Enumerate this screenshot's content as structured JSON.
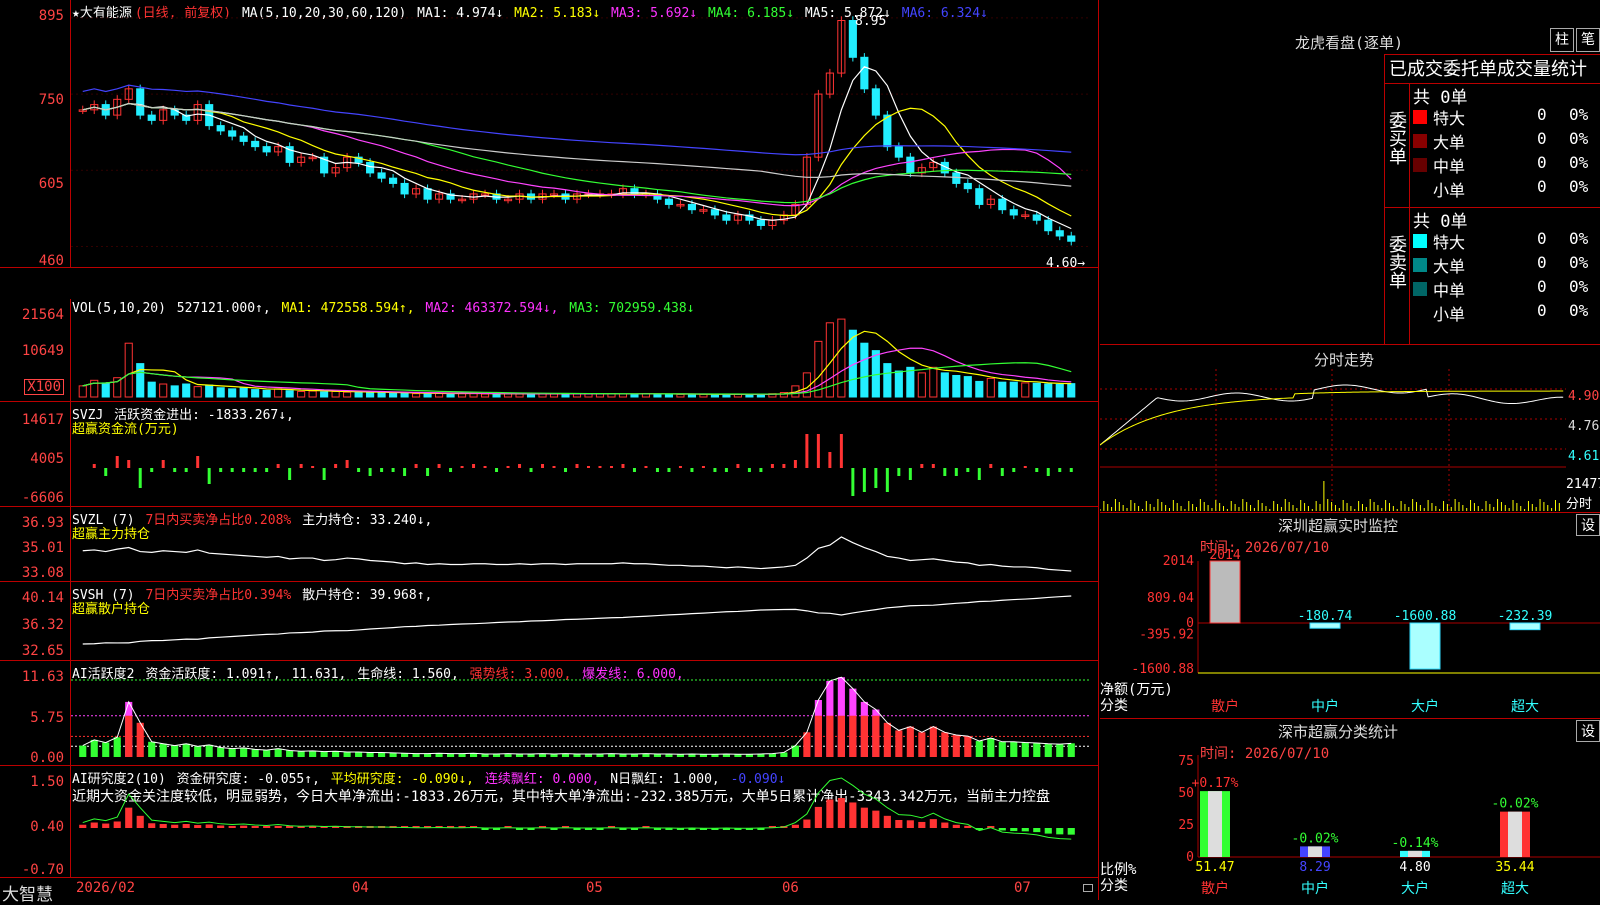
{
  "colors": {
    "up": "#ff3333",
    "down": "#22eeff",
    "ma1": "#ffffff",
    "ma2": "#ffff00",
    "ma3": "#ff44ff",
    "ma4": "#33ff33",
    "ma5": "#cccccc",
    "ma6": "#4444ff",
    "grid": "#aa0000"
  },
  "main": {
    "title": "★大有能源",
    "mode": "(日线, 前复权)",
    "legend": [
      "MA(5,10,20,30,60,120)",
      "MA1: 4.974↓",
      "MA2: 5.183↓",
      "MA3: 5.692↓",
      "MA4: 6.185↓",
      "MA5: 5.872↓",
      "MA6: 6.324↓"
    ],
    "ticks": [
      "895",
      "750",
      "605",
      "460"
    ],
    "high_label": "8.95",
    "low_label": "4.60→"
  },
  "vol": {
    "legend": [
      "VOL(5,10,20)",
      "527121.000↑,",
      "MA1: 472558.594↑,",
      "MA2: 463372.594↓,",
      "MA3: 702959.438↓"
    ],
    "ticks": [
      "21564",
      "10649",
      "X100"
    ]
  },
  "svzj": {
    "legend": [
      "SVZJ",
      "活跃资金进出: -1833.267↓,"
    ],
    "sub": "超赢资金流(万元)",
    "ticks": [
      "14617",
      "4005",
      "-6606"
    ]
  },
  "svzl": {
    "legend": [
      "SVZL (7)",
      "7日内买卖净占比0.208%",
      "主力持仓: 33.240↓,"
    ],
    "sub": "超赢主力持仓",
    "ticks": [
      "36.93",
      "35.01",
      "33.08"
    ]
  },
  "svsh": {
    "legend": [
      "SVSH (7)",
      "7日内买卖净占比0.394%",
      "散户持仓: 39.968↑,"
    ],
    "sub": "超赢散户持仓",
    "ticks": [
      "40.14",
      "36.32",
      "32.65"
    ]
  },
  "ai1": {
    "legend": [
      "AI活跃度2",
      "资金活跃度: 1.091↑,",
      "11.631,",
      "生命线: 1.560,",
      "强势线: 3.000,",
      "爆发线: 6.000,"
    ],
    "ticks": [
      "11.63",
      "5.75",
      "0.00"
    ]
  },
  "ai2": {
    "legend": [
      "AI研究度2(10)",
      "资金研究度: -0.055↑,",
      "平均研究度: -0.090↓,",
      "连续飘红: 0.000,",
      "N日飘红: 1.000,",
      "-0.090↓"
    ],
    "text": "近期大资金关注度较低，明显弱势，今日大单净流出:-1833.26万元，其中特大单净流出:-232.385万元，大单5日累计净出-3343.342万元，当前主力控盘",
    "ticks": [
      "1.50",
      "0.40",
      "-0.70"
    ]
  },
  "bottom": {
    "brand": "大智慧",
    "dates": [
      "2026/02",
      "04",
      "05",
      "06",
      "07"
    ]
  },
  "right": {
    "dragon": {
      "title": "龙虎看盘(逐单)",
      "btn1": "柱",
      "btn2": "笔",
      "header": "已成交委托单成交量统计",
      "buy_label": "委买单",
      "sell_label": "委卖单",
      "buy_total": "共 0单",
      "sell_total": "共 0单",
      "rows_buy": [
        {
          "name": "特大",
          "v": "0",
          "p": "0%"
        },
        {
          "name": "大单",
          "v": "0",
          "p": "0%"
        },
        {
          "name": "中单",
          "v": "0",
          "p": "0%"
        },
        {
          "name": "小单",
          "v": "0",
          "p": "0%"
        }
      ],
      "rows_sell": [
        {
          "name": "特大",
          "v": "0",
          "p": "0%"
        },
        {
          "name": "大单",
          "v": "0",
          "p": "0%"
        },
        {
          "name": "中单",
          "v": "0",
          "p": "0%"
        },
        {
          "name": "小单",
          "v": "0",
          "p": "0%"
        }
      ]
    },
    "intraday": {
      "title": "分时走势",
      "ticks": [
        "4.905",
        "4.760",
        "4.615"
      ],
      "vol_label": "21477",
      "vol_unit": "分时"
    },
    "monitor": {
      "title": "深圳超赢实时监控",
      "btn": "设",
      "time": "时间: 2026/07/10",
      "ticks": [
        "2014",
        "809.04",
        "0",
        "-395.92",
        "-1600.88"
      ],
      "ylabel1": "净额(万元)",
      "ylabel2": "分类",
      "bars": [
        {
          "cat": "散户",
          "value": 2014,
          "label": "2014"
        },
        {
          "cat": "中户",
          "value": -180.74,
          "label": "-180.74"
        },
        {
          "cat": "大户",
          "value": -1600.88,
          "label": "-1600.88"
        },
        {
          "cat": "超大",
          "value": -232.39,
          "label": "-232.39"
        }
      ]
    },
    "classify": {
      "title": "深市超赢分类统计",
      "btn": "设",
      "time": "时间: 2026/07/10",
      "ticks": [
        "75",
        "50",
        "25",
        "0"
      ],
      "ylabel1": "比例%",
      "ylabel2": "分类",
      "bars": [
        {
          "cat": "散户",
          "value": 51.47,
          "label": "51.47",
          "chg": "+0.17%"
        },
        {
          "cat": "中户",
          "value": 8.29,
          "label": "8.29",
          "chg": "-0.02%"
        },
        {
          "cat": "大户",
          "value": 4.8,
          "label": "4.80",
          "chg": "-0.14%"
        },
        {
          "cat": "超大",
          "value": 35.44,
          "label": "35.44",
          "chg": "-0.02%"
        }
      ]
    }
  },
  "chart_data": {
    "type": "candlestick",
    "title": "★大有能源",
    "ylim": [
      4.4,
      9.1
    ],
    "close": [
      7.2,
      7.3,
      7.1,
      7.4,
      7.6,
      7.1,
      7.0,
      7.2,
      7.1,
      7.0,
      7.3,
      6.9,
      6.8,
      6.7,
      6.6,
      6.5,
      6.4,
      6.5,
      6.2,
      6.3,
      6.3,
      6.0,
      6.1,
      6.3,
      6.2,
      6.0,
      5.9,
      5.8,
      5.6,
      5.7,
      5.5,
      5.6,
      5.5,
      5.5,
      5.6,
      5.6,
      5.5,
      5.5,
      5.6,
      5.5,
      5.6,
      5.6,
      5.5,
      5.6,
      5.6,
      5.6,
      5.6,
      5.7,
      5.6,
      5.6,
      5.5,
      5.4,
      5.4,
      5.3,
      5.3,
      5.2,
      5.1,
      5.2,
      5.1,
      5.0,
      5.1,
      5.2,
      5.4,
      6.3,
      7.5,
      7.9,
      8.9,
      8.2,
      7.6,
      7.1,
      6.5,
      6.3,
      6.0,
      6.1,
      6.2,
      6.0,
      5.8,
      5.7,
      5.4,
      5.5,
      5.3,
      5.2,
      5.2,
      5.1,
      4.9,
      4.8,
      4.7
    ],
    "volume": [
      3000,
      4500,
      3800,
      5200,
      14500,
      9000,
      4000,
      3500,
      3000,
      3500,
      2800,
      3200,
      2500,
      2200,
      2400,
      2000,
      1800,
      2200,
      1700,
      1500,
      1600,
      1400,
      1500,
      1300,
      1300,
      1200,
      1200,
      1100,
      1000,
      900,
      900,
      1000,
      900,
      900,
      1000,
      800,
      800,
      900,
      800,
      800,
      900,
      800,
      900,
      800,
      800,
      800,
      900,
      800,
      800,
      900,
      800,
      800,
      700,
      800,
      700,
      700,
      800,
      700,
      700,
      800,
      900,
      1200,
      3000,
      6500,
      15000,
      20000,
      21000,
      18000,
      14500,
      12500,
      9000,
      7000,
      8000,
      6500,
      8000,
      6500,
      5800,
      5500,
      4200,
      5000,
      4000,
      4000,
      3800,
      3700,
      3500,
      3400,
      3600
    ]
  }
}
